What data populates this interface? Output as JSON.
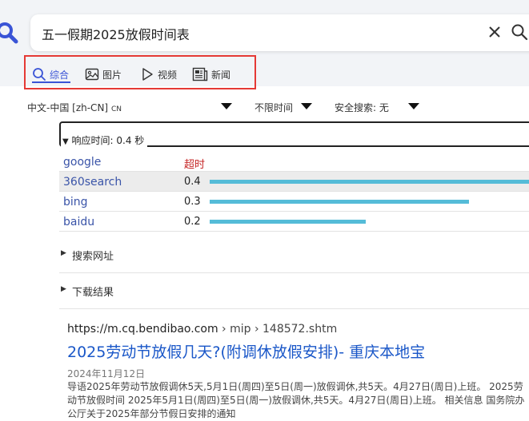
{
  "search": {
    "query": "五一假期2025放假时间表"
  },
  "tabs": [
    {
      "label": "综合",
      "icon": "search-icon",
      "active": true
    },
    {
      "label": "图片",
      "icon": "image-icon"
    },
    {
      "label": "视频",
      "icon": "play-icon"
    },
    {
      "label": "新闻",
      "icon": "news-icon"
    }
  ],
  "filters": {
    "language": "中文-中国 [zh-CN]",
    "language_code": "CN",
    "time": "不限时间",
    "safe_search": "安全搜索: 无"
  },
  "response": {
    "summary": "响应时间: 0.4 秒"
  },
  "engines": [
    {
      "name": "google",
      "time": "超时",
      "timeout": true,
      "bar_fraction": 0
    },
    {
      "name": "360search",
      "time": "0.4",
      "bar_fraction": 1.0
    },
    {
      "name": "bing",
      "time": "0.3",
      "bar_fraction": 0.787
    },
    {
      "name": "baidu",
      "time": "0.2",
      "bar_fraction": 0.473
    }
  ],
  "sections": {
    "search_urls": "搜索网址",
    "download_results": "下载结果"
  },
  "result": {
    "domain": "https://m.cq.bendibao.com",
    "path_1": "› mip",
    "path_2": "› 148572.shtm",
    "title": "2025劳动节放假几天?(附调休放假安排)- 重庆本地宝",
    "date": "2024年11月12日",
    "snippet": "导语2025年劳动节放假调休5天,5月1日(周四)至5日(周一)放假调休,共5天。4月27日(周日)上班。 2025劳动节放假时间 2025年5月1日(周四)至5日(周一)放假调休,共5天。4月27日(周日)上班。 相关信息 国务院办公厅关于2025年部分节假日安排的通知"
  },
  "colors": {
    "accent": "#3a54d6",
    "highlight_border": "#e53935",
    "bar": "#55bcd8",
    "link": "#1a57c8"
  }
}
